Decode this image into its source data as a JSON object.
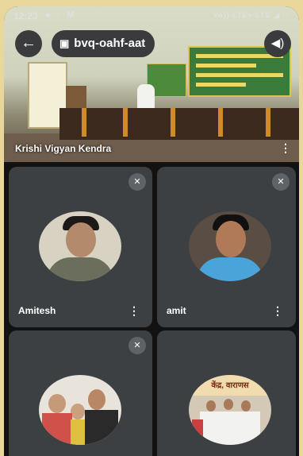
{
  "status_bar": {
    "time": "12:23",
    "left_icons": "● ○ M",
    "right_icons": "Vo)) LTE+ LTE ◢ □"
  },
  "meeting": {
    "back_icon": "←",
    "calendar_icon": "▣",
    "code": "bvq-oahf-aat",
    "speaker_icon": "◀)"
  },
  "main_tile": {
    "participant_name": "Krishi Vigyan Kendra",
    "menu_icon": "⋮"
  },
  "tiles": [
    {
      "name": "Amitesh",
      "muted": true,
      "mute_icon": "✕",
      "menu_icon": "⋮"
    },
    {
      "name": "amit",
      "muted": true,
      "mute_icon": "✕",
      "menu_icon": "⋮"
    },
    {
      "name": "",
      "muted": true,
      "mute_icon": "✕",
      "menu_icon": ""
    },
    {
      "name": "",
      "muted": false,
      "mute_icon": "",
      "menu_icon": ""
    }
  ],
  "tile4_banner_text": "केंद्र, वाराणस",
  "colors": {
    "tile_background": "#3c4043",
    "page_background": "#e9d69a",
    "chip_background": "#3a3b3d"
  }
}
